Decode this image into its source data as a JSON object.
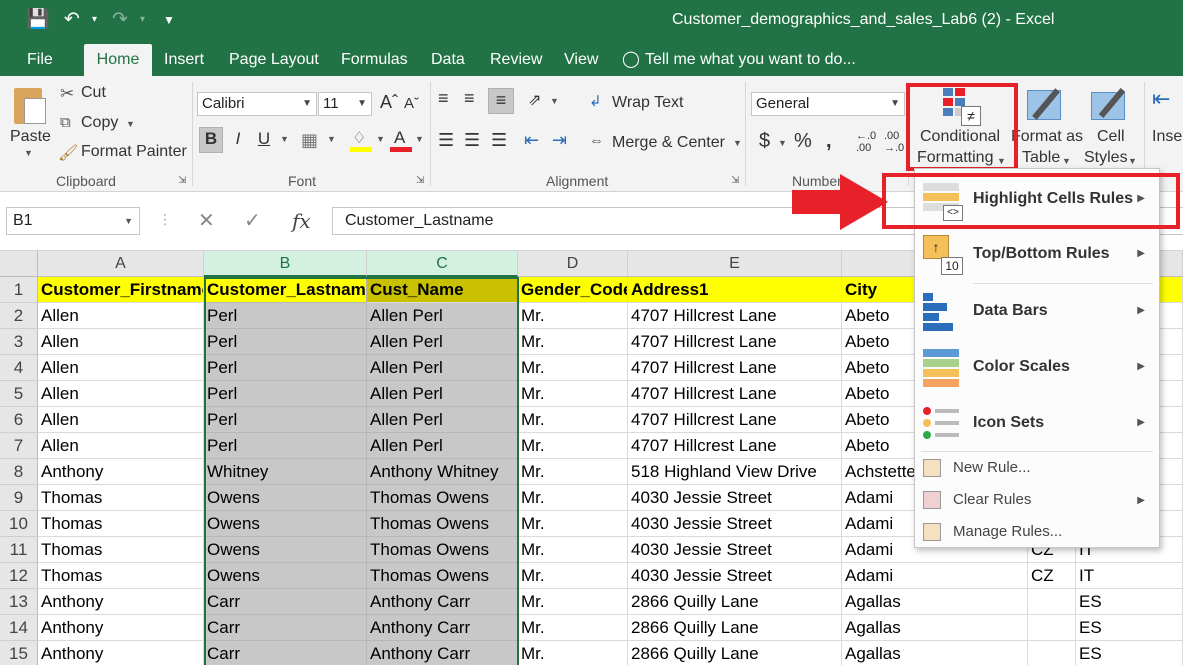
{
  "window": {
    "title": "Customer_demographics_and_sales_Lab6 (2) - Excel"
  },
  "tabs": [
    {
      "label": "File"
    },
    {
      "label": "Home"
    },
    {
      "label": "Insert"
    },
    {
      "label": "Page Layout"
    },
    {
      "label": "Formulas"
    },
    {
      "label": "Data"
    },
    {
      "label": "Review"
    },
    {
      "label": "View"
    }
  ],
  "tell_me": "Tell me what you want to do...",
  "clipboard": {
    "paste": "Paste",
    "cut": "Cut",
    "copy": "Copy",
    "format_painter": "Format Painter",
    "group": "Clipboard"
  },
  "font": {
    "name": "Calibri",
    "size": "11",
    "group": "Font",
    "bold": "B",
    "italic": "I",
    "underline": "U"
  },
  "alignment": {
    "wrap_text": "Wrap Text",
    "merge_center": "Merge & Center",
    "group": "Alignment"
  },
  "number": {
    "format": "General",
    "currency": "$",
    "percent": "%",
    "comma": "\u0019",
    "group": "Number",
    "inc_decimal_top": "←.0",
    "inc_decimal_bottom": ".00",
    "dec_decimal_top": ".00",
    "dec_decimal_bottom": "→.0"
  },
  "styles": {
    "conditional_line1": "Conditional",
    "conditional_line2": "Formatting",
    "format_table_line1": "Format as",
    "format_table_line2": "Table",
    "cell_styles_line1": "Cell",
    "cell_styles_line2": "Styles",
    "insert": "Insert"
  },
  "formula_bar": {
    "name_box": "B1",
    "fx": "fx",
    "content": "Customer_Lastname"
  },
  "columns": [
    "A",
    "B",
    "C",
    "D",
    "E",
    "F",
    "G",
    "H"
  ],
  "rows": [
    {
      "n": "1",
      "cells": [
        "Customer_Firstname",
        "Customer_Lastname",
        "Cust_Name",
        "Gender_Code",
        "Address1",
        "City",
        "",
        "Code"
      ]
    },
    {
      "n": "2",
      "cells": [
        "Allen",
        "Perl",
        "Allen Perl",
        "Mr.",
        "4707 Hillcrest Lane",
        "Abeto",
        "",
        ""
      ]
    },
    {
      "n": "3",
      "cells": [
        "Allen",
        "Perl",
        "Allen Perl",
        "Mr.",
        "4707 Hillcrest Lane",
        "Abeto",
        "",
        ""
      ]
    },
    {
      "n": "4",
      "cells": [
        "Allen",
        "Perl",
        "Allen Perl",
        "Mr.",
        "4707 Hillcrest Lane",
        "Abeto",
        "",
        ""
      ]
    },
    {
      "n": "5",
      "cells": [
        "Allen",
        "Perl",
        "Allen Perl",
        "Mr.",
        "4707 Hillcrest Lane",
        "Abeto",
        "",
        ""
      ]
    },
    {
      "n": "6",
      "cells": [
        "Allen",
        "Perl",
        "Allen Perl",
        "Mr.",
        "4707 Hillcrest Lane",
        "Abeto",
        "",
        ""
      ]
    },
    {
      "n": "7",
      "cells": [
        "Allen",
        "Perl",
        "Allen Perl",
        "Mr.",
        "4707 Hillcrest Lane",
        "Abeto",
        "",
        ""
      ]
    },
    {
      "n": "8",
      "cells": [
        "Anthony",
        "Whitney",
        "Anthony Whitney",
        "Mr.",
        "518 Highland View Drive",
        "Achstetten",
        "",
        ""
      ]
    },
    {
      "n": "9",
      "cells": [
        "Thomas",
        "Owens",
        "Thomas Owens",
        "Mr.",
        "4030 Jessie Street",
        "Adami",
        "",
        ""
      ]
    },
    {
      "n": "10",
      "cells": [
        "Thomas",
        "Owens",
        "Thomas Owens",
        "Mr.",
        "4030 Jessie Street",
        "Adami",
        "",
        ""
      ]
    },
    {
      "n": "11",
      "cells": [
        "Thomas",
        "Owens",
        "Thomas Owens",
        "Mr.",
        "4030 Jessie Street",
        "Adami",
        "CZ",
        "IT"
      ]
    },
    {
      "n": "12",
      "cells": [
        "Thomas",
        "Owens",
        "Thomas Owens",
        "Mr.",
        "4030 Jessie Street",
        "Adami",
        "CZ",
        "IT"
      ]
    },
    {
      "n": "13",
      "cells": [
        "Anthony",
        "Carr",
        "Anthony Carr",
        "Mr.",
        "2866 Quilly Lane",
        "Agallas",
        "",
        "ES"
      ]
    },
    {
      "n": "14",
      "cells": [
        "Anthony",
        "Carr",
        "Anthony Carr",
        "Mr.",
        "2866 Quilly Lane",
        "Agallas",
        "",
        "ES"
      ]
    },
    {
      "n": "15",
      "cells": [
        "Anthony",
        "Carr",
        "Anthony Carr",
        "Mr.",
        "2866 Quilly Lane",
        "Agallas",
        "",
        "ES"
      ]
    }
  ],
  "cf_menu": {
    "items": [
      {
        "label": "Highlight Cells Rules",
        "icon": "highlight-cells-icon"
      },
      {
        "label": "Top/Bottom Rules",
        "icon": "top-bottom-icon",
        "badge": "10"
      },
      {
        "label": "Data Bars",
        "icon": "data-bars-icon"
      },
      {
        "label": "Color Scales",
        "icon": "color-scales-icon"
      },
      {
        "label": "Icon Sets",
        "icon": "icon-sets-icon"
      }
    ],
    "new_rule": "New Rule...",
    "clear_rules": "Clear Rules",
    "manage_rules": "Manage Rules..."
  },
  "colors": {
    "excel_green": "#217346",
    "highlight_yellow": "#ffff00",
    "annotation_red": "#e8202a"
  }
}
